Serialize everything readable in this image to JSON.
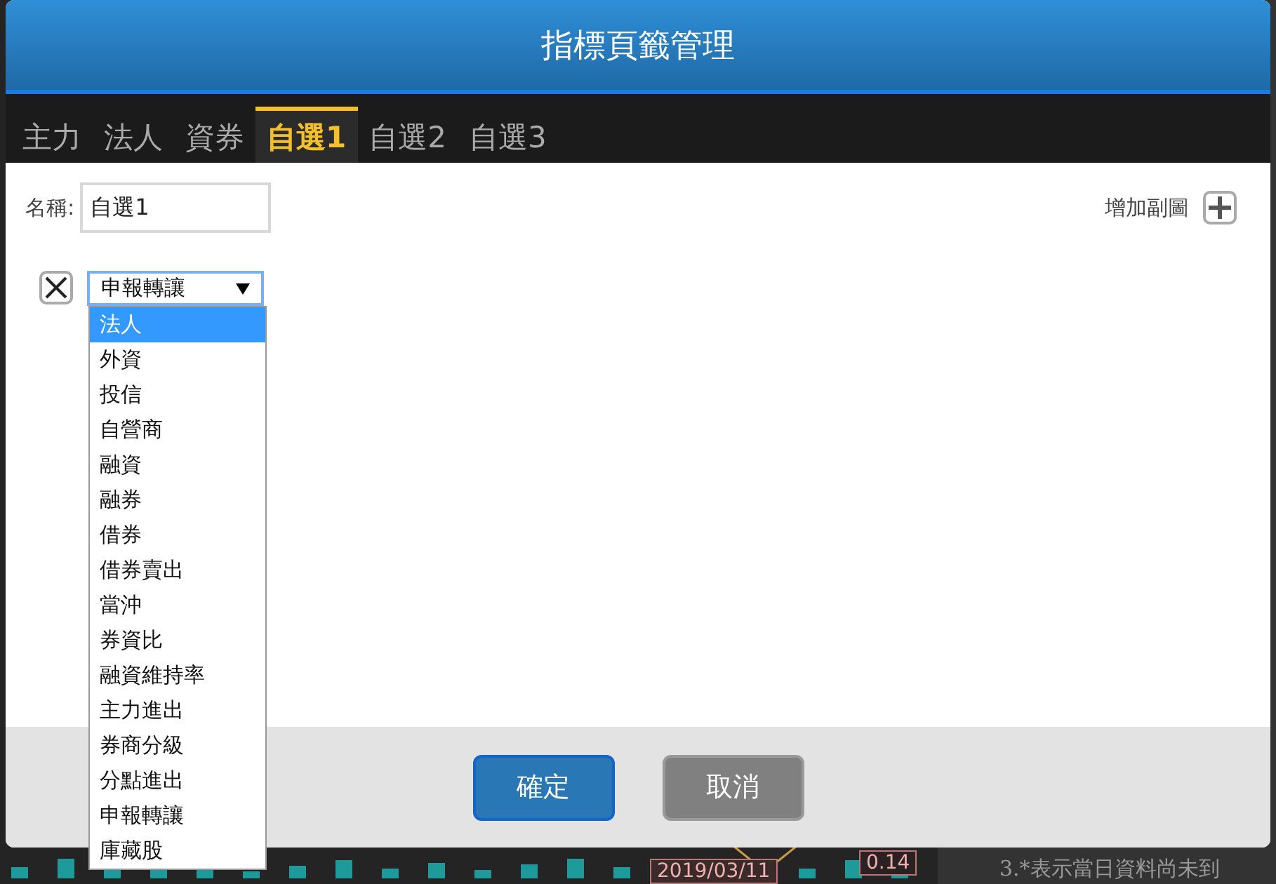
{
  "dialog": {
    "title": "指標頁籤管理",
    "tabs": [
      {
        "label": "主力",
        "selected": false
      },
      {
        "label": "法人",
        "selected": false
      },
      {
        "label": "資券",
        "selected": false
      },
      {
        "label": "自選1",
        "selected": true
      },
      {
        "label": "自選2",
        "selected": false
      },
      {
        "label": "自選3",
        "selected": false
      }
    ],
    "name_label": "名稱:",
    "name_value": "自選1",
    "add_label": "增加副圖",
    "indicator": {
      "value": "申報轉讓",
      "expanded": true,
      "options": [
        {
          "label": "法人",
          "highlighted": true
        },
        {
          "label": "外資",
          "highlighted": false
        },
        {
          "label": "投信",
          "highlighted": false
        },
        {
          "label": "自營商",
          "highlighted": false
        },
        {
          "label": "融資",
          "highlighted": false
        },
        {
          "label": "融券",
          "highlighted": false
        },
        {
          "label": "借券",
          "highlighted": false
        },
        {
          "label": "借券賣出",
          "highlighted": false
        },
        {
          "label": "當沖",
          "highlighted": false
        },
        {
          "label": "券資比",
          "highlighted": false
        },
        {
          "label": "融資維持率",
          "highlighted": false
        },
        {
          "label": "主力進出",
          "highlighted": false
        },
        {
          "label": "券商分級",
          "highlighted": false
        },
        {
          "label": "分點進出",
          "highlighted": false
        },
        {
          "label": "申報轉讓",
          "highlighted": false
        },
        {
          "label": "庫藏股",
          "highlighted": false
        }
      ]
    },
    "buttons": [
      {
        "label": "確定",
        "kind": "primary"
      },
      {
        "label": "取消",
        "kind": "secondary"
      }
    ]
  },
  "background": {
    "value_tag": "0.14",
    "date_tag": "2019/03/11",
    "note": "3.*表示當日資料尚未到"
  }
}
